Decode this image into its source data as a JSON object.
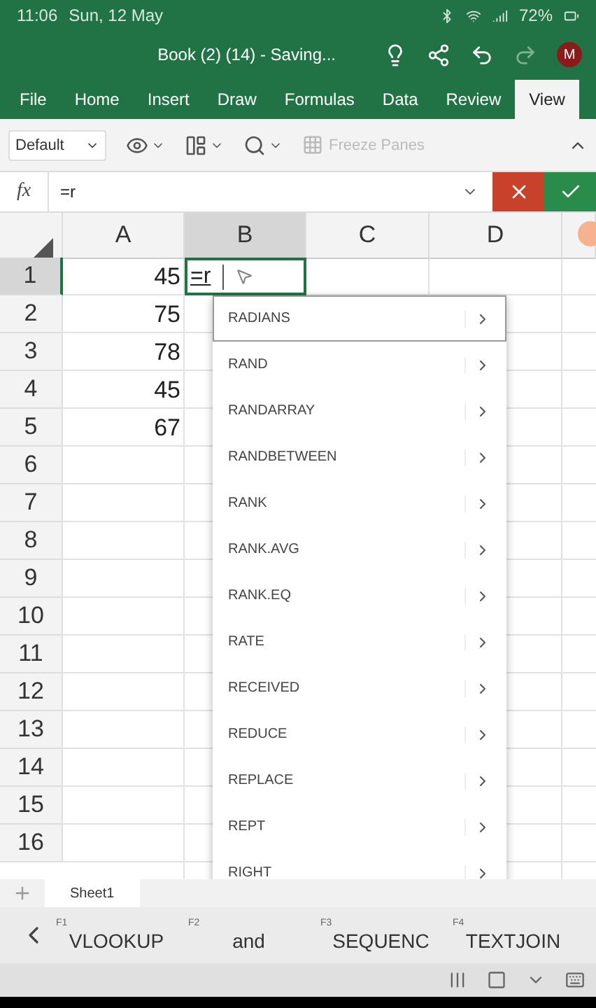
{
  "status_bar": {
    "time": "11:06",
    "date": "Sun, 12 May",
    "battery": "72%"
  },
  "title_bar": {
    "title": "Book (2) (14) - Saving...",
    "avatar": "M"
  },
  "tabs": [
    {
      "label": "File",
      "selected": false
    },
    {
      "label": "Home",
      "selected": false
    },
    {
      "label": "Insert",
      "selected": false
    },
    {
      "label": "Draw",
      "selected": false
    },
    {
      "label": "Formulas",
      "selected": false
    },
    {
      "label": "Data",
      "selected": false
    },
    {
      "label": "Review",
      "selected": false
    },
    {
      "label": "View",
      "selected": true
    }
  ],
  "toolbar": {
    "view_select": "Default",
    "freeze_panes": {
      "label": "Freeze Panes",
      "disabled": true
    }
  },
  "formula_bar": {
    "fx": "fx",
    "value": "=r"
  },
  "columns": [
    {
      "label": "A",
      "selected": false
    },
    {
      "label": "B",
      "selected": true
    },
    {
      "label": "C",
      "selected": false
    },
    {
      "label": "D",
      "selected": false
    }
  ],
  "rows": [
    {
      "number": "1",
      "a": "45",
      "selected": true
    },
    {
      "number": "2",
      "a": "75",
      "selected": false
    },
    {
      "number": "3",
      "a": "78",
      "selected": false
    },
    {
      "number": "4",
      "a": "45",
      "selected": false
    },
    {
      "number": "5",
      "a": "67",
      "selected": false
    },
    {
      "number": "6",
      "selected": false
    },
    {
      "number": "7",
      "selected": false
    },
    {
      "number": "8",
      "selected": false
    },
    {
      "number": "9",
      "selected": false
    },
    {
      "number": "10",
      "selected": false
    },
    {
      "number": "11",
      "selected": false
    },
    {
      "number": "12",
      "selected": false
    },
    {
      "number": "13",
      "selected": false
    },
    {
      "number": "14",
      "selected": false
    },
    {
      "number": "15",
      "selected": false
    },
    {
      "number": "16",
      "selected": false
    }
  ],
  "editing_cell": {
    "value": "=r"
  },
  "suggestions": [
    {
      "label": "RADIANS",
      "selected": true
    },
    {
      "label": "RAND",
      "selected": false
    },
    {
      "label": "RANDARRAY",
      "selected": false
    },
    {
      "label": "RANDBETWEEN",
      "selected": false
    },
    {
      "label": "RANK",
      "selected": false
    },
    {
      "label": "RANK.AVG",
      "selected": false
    },
    {
      "label": "RANK.EQ",
      "selected": false
    },
    {
      "label": "RATE",
      "selected": false
    },
    {
      "label": "RECEIVED",
      "selected": false
    },
    {
      "label": "REDUCE",
      "selected": false
    },
    {
      "label": "REPLACE",
      "selected": false
    },
    {
      "label": "REPT",
      "selected": false
    },
    {
      "label": "RIGHT",
      "selected": false
    }
  ],
  "sheets": [
    {
      "label": "Sheet1",
      "selected": true
    }
  ],
  "keyboard_suggestions": [
    {
      "key": "F1",
      "label": "VLOOKUP"
    },
    {
      "key": "F2",
      "label": "and"
    },
    {
      "key": "F3",
      "label": "SEQUENC"
    },
    {
      "key": "F4",
      "label": "TEXTJOIN"
    }
  ]
}
